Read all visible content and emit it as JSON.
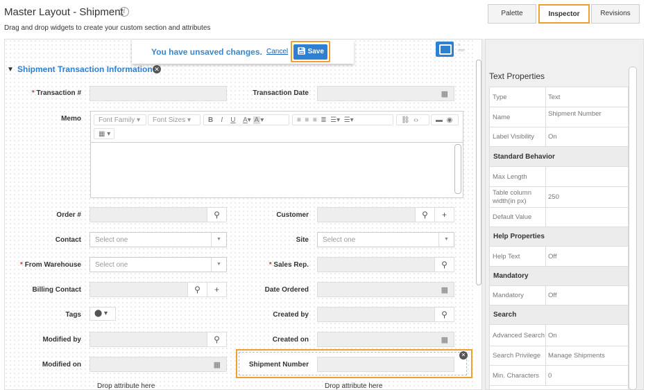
{
  "header": {
    "title": "Master Layout - Shipment",
    "info_icon": "info-icon",
    "subtitle": "Drag and drop widgets to create your custom section and attributes"
  },
  "notice": {
    "text": "You have unsaved changes.",
    "cancel": "Cancel",
    "save": "Save",
    "save_icon": "floppy-disk-icon",
    "highlight_color": "#f0a030"
  },
  "view_toggles": [
    "tablet-icon",
    "grid-icon"
  ],
  "section": {
    "title": "Shipment Transaction Information",
    "collapse_icon": "chevron-down-icon",
    "close_icon": "close-icon"
  },
  "fields": {
    "transaction_no": "Transaction #",
    "transaction_date": "Transaction Date",
    "memo": "Memo",
    "order_no": "Order #",
    "customer": "Customer",
    "contact": "Contact",
    "contact_placeholder": "Select one",
    "site": "Site",
    "site_placeholder": "Select one",
    "from_warehouse": "From Warehouse",
    "from_warehouse_placeholder": "Select one",
    "sales_rep": "Sales Rep.",
    "billing_contact": "Billing Contact",
    "date_ordered": "Date Ordered",
    "tags": "Tags",
    "created_by": "Created by",
    "modified_by": "Modified by",
    "created_on": "Created on",
    "modified_on": "Modified on",
    "shipment_number": "Shipment Number",
    "required_marker": "*",
    "drop_left": "Drop attribute here",
    "drop_right": "Drop attribute here"
  },
  "editor": {
    "font_family": "Font Family",
    "font_sizes": "Font Sizes",
    "bold": "B",
    "italic": "I",
    "underline": "U",
    "font_color": "A",
    "bg_color": "A"
  },
  "tabs": [
    "Palette",
    "Inspector",
    "Revisions"
  ],
  "inspector": {
    "title": "Text Properties",
    "rows": [
      {
        "k": "Type",
        "v": "Text"
      },
      {
        "k": "Name",
        "v": "Shipment Number"
      },
      {
        "k": "Label Visibility",
        "v": "On"
      },
      {
        "head": "Standard Behavior"
      },
      {
        "k": "Max Length",
        "v": ""
      },
      {
        "k": "Table column width(in px)",
        "v": "250"
      },
      {
        "k": "Default Value",
        "v": ""
      },
      {
        "head": "Help Properties"
      },
      {
        "k": "Help Text",
        "v": "Off"
      },
      {
        "head": "Mandatory"
      },
      {
        "k": "Mandatory",
        "v": "Off"
      },
      {
        "head": "Search"
      },
      {
        "k": "Advanced Search",
        "v": "On"
      },
      {
        "k": "Search Privilege",
        "v": "Manage Shipments"
      },
      {
        "k": "Min. Characters",
        "v": "0"
      }
    ]
  }
}
